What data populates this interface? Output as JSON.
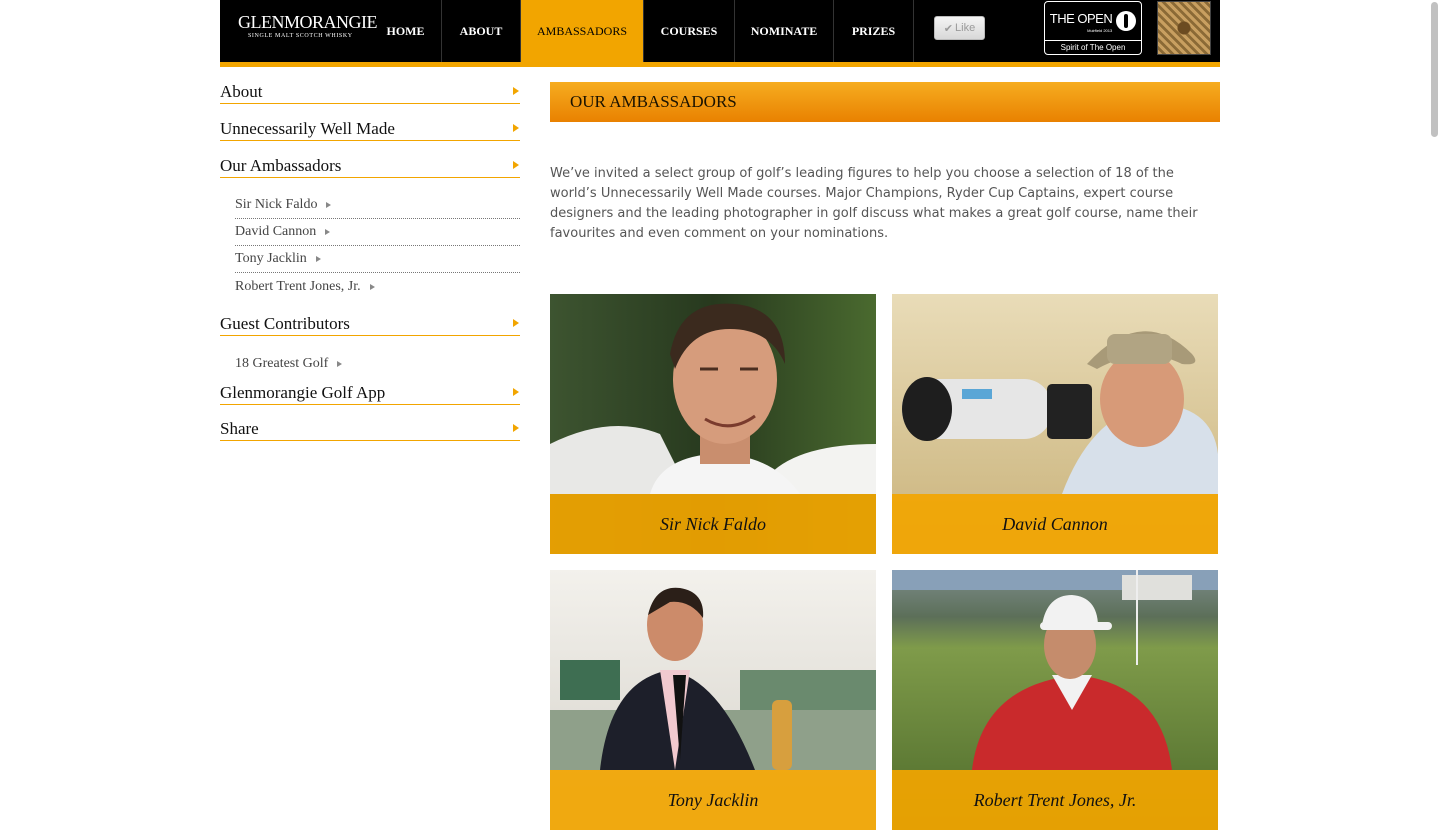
{
  "header": {
    "logo": {
      "name": "GLENMORANGIE",
      "tagline": "SINGLE MALT SCOTCH WHISKY"
    },
    "nav": [
      {
        "label": "HOME"
      },
      {
        "label": "ABOUT"
      },
      {
        "label": "AMBASSADORS",
        "active": true
      },
      {
        "label": "COURSES"
      },
      {
        "label": "NOMINATE"
      },
      {
        "label": "PRIZES"
      }
    ],
    "like_label": "Like",
    "open_badge": {
      "title": "THE OPEN",
      "small": "Muirfield 2013",
      "spirit": "Spirit of The Open"
    },
    "accent_color": "#f2a500"
  },
  "sidebar": {
    "sections": [
      {
        "label": "About"
      },
      {
        "label": "Unnecessarily Well Made"
      },
      {
        "label": "Our Ambassadors",
        "items": [
          "Sir Nick Faldo",
          "David Cannon",
          "Tony Jacklin",
          "Robert Trent Jones, Jr."
        ]
      },
      {
        "label": "Guest Contributors",
        "items": [
          "18 Greatest Golf"
        ]
      },
      {
        "label": "Glenmorangie Golf App"
      },
      {
        "label": "Share"
      }
    ]
  },
  "main": {
    "title": "OUR AMBASSADORS",
    "intro": "We’ve invited a select group of golf’s leading figures to help you choose a selection of 18 of the world’s Unnecessarily Well Made courses. Major Champions, Ryder Cup Captains, expert course designers and the leading photographer in golf discuss what makes a great golf course, name their favourites and even comment on your nominations.",
    "ambassadors": [
      {
        "name": "Sir Nick Faldo"
      },
      {
        "name": "David Cannon"
      },
      {
        "name": "Tony Jacklin"
      },
      {
        "name": "Robert Trent Jones, Jr."
      }
    ]
  }
}
